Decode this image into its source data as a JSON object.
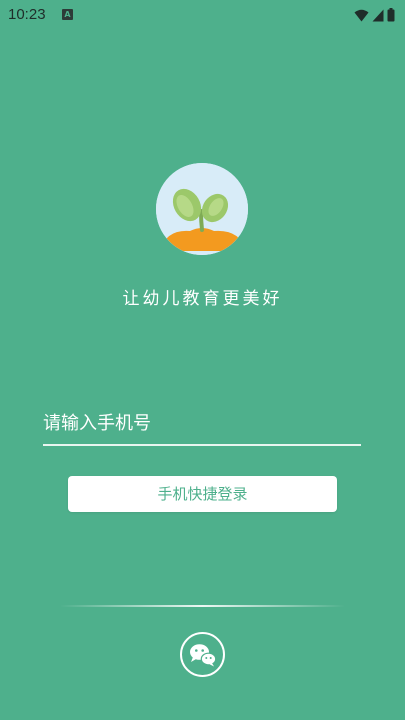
{
  "status_bar": {
    "time": "10:23",
    "notification_letter": "A",
    "icons": [
      "wifi-icon",
      "signal-icon",
      "battery-icon"
    ]
  },
  "slogan": "让幼儿教育更美好",
  "phone_input": {
    "placeholder": "请输入手机号",
    "value": ""
  },
  "login_button_label": "手机快捷登录",
  "wechat_icon": "wechat-icon",
  "colors": {
    "background": "#4eb08c",
    "button_bg": "#ffffff",
    "button_text": "#4eb08c",
    "logo_sky": "#d8ecf8",
    "logo_soil": "#f39a1f",
    "logo_leaf": "#9cc86a"
  }
}
